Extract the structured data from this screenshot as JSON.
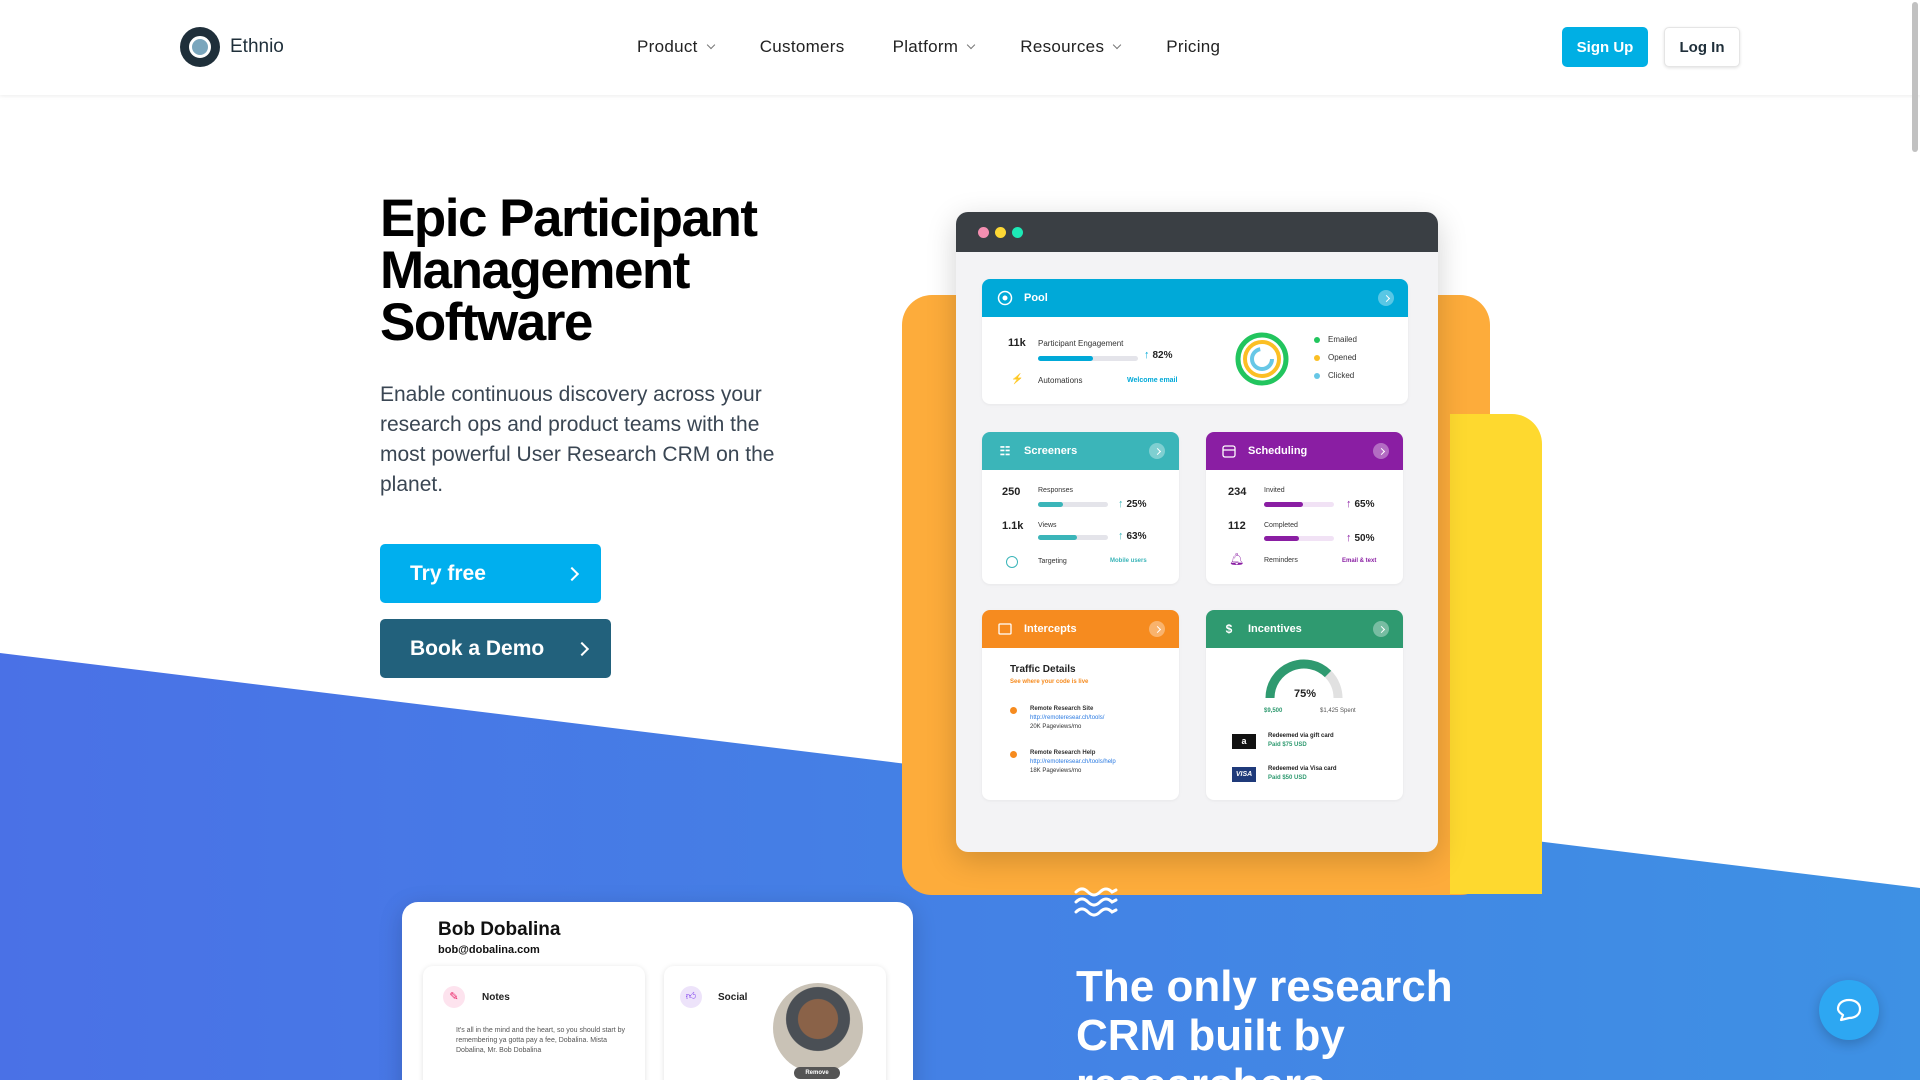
{
  "nav": {
    "logo_text": "Ethnio",
    "menu": [
      {
        "label": "Product",
        "has_dropdown": true
      },
      {
        "label": "Customers",
        "has_dropdown": false
      },
      {
        "label": "Platform",
        "has_dropdown": true
      },
      {
        "label": "Resources",
        "has_dropdown": true
      },
      {
        "label": "Pricing",
        "has_dropdown": false
      }
    ],
    "signup_label": "Sign Up",
    "login_label": "Log In"
  },
  "hero": {
    "title": "Epic Participant Management Software",
    "subtitle": "Enable continuous discovery across your research ops and product teams with the most powerful User Research CRM on the planet.",
    "try_label": "Try free",
    "demo_label": "Book a Demo"
  },
  "dashboard": {
    "pool": {
      "title": "Pool",
      "engagement_count": "11k",
      "engagement_label": "Participant Engagement",
      "engagement_pct": "82%",
      "engagement_fill": 0.55,
      "automations_label": "Automations",
      "automations_link": "Welcome email",
      "legend": [
        "Emailed",
        "Opened",
        "Clicked"
      ]
    },
    "screeners": {
      "title": "Screeners",
      "rows": [
        {
          "num": "250",
          "label": "Responses",
          "pct": "25%",
          "fill": 0.35
        },
        {
          "num": "1.1k",
          "label": "Views",
          "pct": "63%",
          "fill": 0.55
        }
      ],
      "targeting_label": "Targeting",
      "targeting_link": "Mobile users"
    },
    "scheduling": {
      "title": "Scheduling",
      "rows": [
        {
          "num": "234",
          "label": "Invited",
          "pct": "65%",
          "fill": 0.55
        },
        {
          "num": "112",
          "label": "Completed",
          "pct": "50%",
          "fill": 0.5
        }
      ],
      "reminders_label": "Reminders",
      "reminders_link": "Email & text"
    },
    "intercepts": {
      "title": "Intercepts",
      "traffic_title": "Traffic Details",
      "traffic_sub": "See where your code is live",
      "sites": [
        {
          "name": "Remote Research Site",
          "url": "http://remoteresear.ch/tools/",
          "views": "20K Pageviews/mo"
        },
        {
          "name": "Remote Research Help",
          "url": "http://remoteresear.ch/tools/help",
          "views": "18K Pageviews/mo"
        }
      ]
    },
    "incentives": {
      "title": "Incentives",
      "gauge_pct": "75%",
      "gauge_fraction": 0.75,
      "budget": "$9,500",
      "spent": "$1,425 Spent",
      "items": [
        {
          "label": "Redeemed via gift card",
          "paid": "Paid $75 USD",
          "brand": "a"
        },
        {
          "label": "Redeemed via Visa card",
          "paid": "Paid $50 USD",
          "brand": "VISA"
        }
      ]
    }
  },
  "profile": {
    "name": "Bob Dobalina",
    "email": "bob@dobalina.com",
    "notes_title": "Notes",
    "notes_text": "It's all in the mind and the heart, so you should start by remembering ya gotta pay a fee, Dobalina. Mista Dobalina, Mr. Bob Dobalina",
    "social_title": "Social",
    "remove_label": "Remove"
  },
  "lower": {
    "title": "The only research CRM built by researchers"
  },
  "colors": {
    "primary": "#00afee",
    "demo": "#22617c",
    "pool": "#00a9d8",
    "screeners": "#3bb5b9",
    "scheduling": "#8a1ea3",
    "intercepts": "#f68b1f",
    "incentives": "#2f9a70",
    "blob_orange": "#fdac3b",
    "blob_yellow": "#fed92f"
  }
}
